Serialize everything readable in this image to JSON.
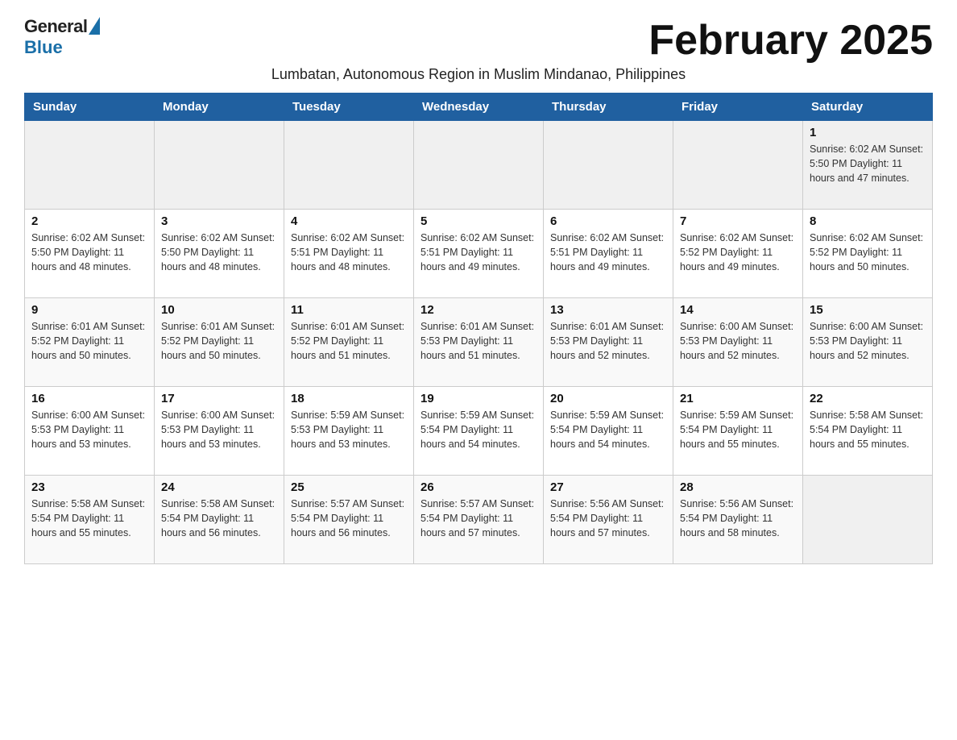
{
  "header": {
    "logo_general": "General",
    "logo_blue": "Blue",
    "month_title": "February 2025",
    "subtitle": "Lumbatan, Autonomous Region in Muslim Mindanao, Philippines"
  },
  "days_of_week": [
    "Sunday",
    "Monday",
    "Tuesday",
    "Wednesday",
    "Thursday",
    "Friday",
    "Saturday"
  ],
  "weeks": [
    {
      "week": 1,
      "days": [
        {
          "date": "",
          "info": ""
        },
        {
          "date": "",
          "info": ""
        },
        {
          "date": "",
          "info": ""
        },
        {
          "date": "",
          "info": ""
        },
        {
          "date": "",
          "info": ""
        },
        {
          "date": "",
          "info": ""
        },
        {
          "date": "1",
          "info": "Sunrise: 6:02 AM\nSunset: 5:50 PM\nDaylight: 11 hours and 47 minutes."
        }
      ]
    },
    {
      "week": 2,
      "days": [
        {
          "date": "2",
          "info": "Sunrise: 6:02 AM\nSunset: 5:50 PM\nDaylight: 11 hours and 48 minutes."
        },
        {
          "date": "3",
          "info": "Sunrise: 6:02 AM\nSunset: 5:50 PM\nDaylight: 11 hours and 48 minutes."
        },
        {
          "date": "4",
          "info": "Sunrise: 6:02 AM\nSunset: 5:51 PM\nDaylight: 11 hours and 48 minutes."
        },
        {
          "date": "5",
          "info": "Sunrise: 6:02 AM\nSunset: 5:51 PM\nDaylight: 11 hours and 49 minutes."
        },
        {
          "date": "6",
          "info": "Sunrise: 6:02 AM\nSunset: 5:51 PM\nDaylight: 11 hours and 49 minutes."
        },
        {
          "date": "7",
          "info": "Sunrise: 6:02 AM\nSunset: 5:52 PM\nDaylight: 11 hours and 49 minutes."
        },
        {
          "date": "8",
          "info": "Sunrise: 6:02 AM\nSunset: 5:52 PM\nDaylight: 11 hours and 50 minutes."
        }
      ]
    },
    {
      "week": 3,
      "days": [
        {
          "date": "9",
          "info": "Sunrise: 6:01 AM\nSunset: 5:52 PM\nDaylight: 11 hours and 50 minutes."
        },
        {
          "date": "10",
          "info": "Sunrise: 6:01 AM\nSunset: 5:52 PM\nDaylight: 11 hours and 50 minutes."
        },
        {
          "date": "11",
          "info": "Sunrise: 6:01 AM\nSunset: 5:52 PM\nDaylight: 11 hours and 51 minutes."
        },
        {
          "date": "12",
          "info": "Sunrise: 6:01 AM\nSunset: 5:53 PM\nDaylight: 11 hours and 51 minutes."
        },
        {
          "date": "13",
          "info": "Sunrise: 6:01 AM\nSunset: 5:53 PM\nDaylight: 11 hours and 52 minutes."
        },
        {
          "date": "14",
          "info": "Sunrise: 6:00 AM\nSunset: 5:53 PM\nDaylight: 11 hours and 52 minutes."
        },
        {
          "date": "15",
          "info": "Sunrise: 6:00 AM\nSunset: 5:53 PM\nDaylight: 11 hours and 52 minutes."
        }
      ]
    },
    {
      "week": 4,
      "days": [
        {
          "date": "16",
          "info": "Sunrise: 6:00 AM\nSunset: 5:53 PM\nDaylight: 11 hours and 53 minutes."
        },
        {
          "date": "17",
          "info": "Sunrise: 6:00 AM\nSunset: 5:53 PM\nDaylight: 11 hours and 53 minutes."
        },
        {
          "date": "18",
          "info": "Sunrise: 5:59 AM\nSunset: 5:53 PM\nDaylight: 11 hours and 53 minutes."
        },
        {
          "date": "19",
          "info": "Sunrise: 5:59 AM\nSunset: 5:54 PM\nDaylight: 11 hours and 54 minutes."
        },
        {
          "date": "20",
          "info": "Sunrise: 5:59 AM\nSunset: 5:54 PM\nDaylight: 11 hours and 54 minutes."
        },
        {
          "date": "21",
          "info": "Sunrise: 5:59 AM\nSunset: 5:54 PM\nDaylight: 11 hours and 55 minutes."
        },
        {
          "date": "22",
          "info": "Sunrise: 5:58 AM\nSunset: 5:54 PM\nDaylight: 11 hours and 55 minutes."
        }
      ]
    },
    {
      "week": 5,
      "days": [
        {
          "date": "23",
          "info": "Sunrise: 5:58 AM\nSunset: 5:54 PM\nDaylight: 11 hours and 55 minutes."
        },
        {
          "date": "24",
          "info": "Sunrise: 5:58 AM\nSunset: 5:54 PM\nDaylight: 11 hours and 56 minutes."
        },
        {
          "date": "25",
          "info": "Sunrise: 5:57 AM\nSunset: 5:54 PM\nDaylight: 11 hours and 56 minutes."
        },
        {
          "date": "26",
          "info": "Sunrise: 5:57 AM\nSunset: 5:54 PM\nDaylight: 11 hours and 57 minutes."
        },
        {
          "date": "27",
          "info": "Sunrise: 5:56 AM\nSunset: 5:54 PM\nDaylight: 11 hours and 57 minutes."
        },
        {
          "date": "28",
          "info": "Sunrise: 5:56 AM\nSunset: 5:54 PM\nDaylight: 11 hours and 58 minutes."
        },
        {
          "date": "",
          "info": ""
        }
      ]
    }
  ]
}
